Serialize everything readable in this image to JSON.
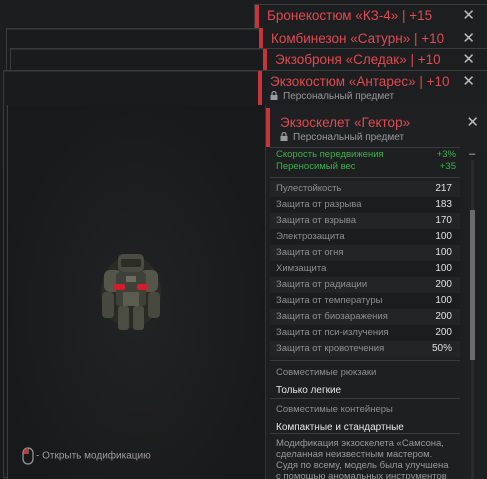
{
  "stack": [
    {
      "title": "Бронекостюм «КЗ-4» | +15"
    },
    {
      "title": "Комбинезон «Сатурн» | +10"
    },
    {
      "title": "Экзоброня «Следак» | +10"
    },
    {
      "title": "Экзокостюм «Антарес» | +10",
      "subtitle": "Персональный предмет"
    }
  ],
  "item": {
    "title": "Экзоскелет «Гектор»",
    "subtitle": "Персональный предмет",
    "modifiers": [
      {
        "label": "Скорость передвижения",
        "value": "+3%"
      },
      {
        "label": "Переносимый вес",
        "value": "+35"
      }
    ],
    "stats": [
      {
        "label": "Пулестойкость",
        "value": "217"
      },
      {
        "label": "Защита от разрыва",
        "value": "183"
      },
      {
        "label": "Защита от взрыва",
        "value": "170"
      },
      {
        "label": "Электрозащита",
        "value": "100"
      },
      {
        "label": "Защита от огня",
        "value": "100"
      },
      {
        "label": "Химзащита",
        "value": "100"
      },
      {
        "label": "Защита от радиации",
        "value": "200"
      },
      {
        "label": "Защита от температуры",
        "value": "100"
      },
      {
        "label": "Защита от биозаражения",
        "value": "200"
      },
      {
        "label": "Защита от пси-излучения",
        "value": "200"
      },
      {
        "label": "Защита от кровотечения",
        "value": "50%"
      }
    ],
    "backpacks_label": "Совместимые рюкзаки",
    "backpacks_value": "Только легкие",
    "containers_label": "Совместимые контейнеры",
    "containers_value": "Компактные и стандартные",
    "description": "Модификация экзоскелета «Самсона, сделанная неизвестным мастером. Судя по всему, модель была улучшена с помощью аномальных инструментов и"
  },
  "hint": "- Открыть модификацию",
  "close_glyph": "✕",
  "colors": {
    "accent": "#c8343b",
    "title": "#e04a52",
    "positive": "#39b54a"
  }
}
